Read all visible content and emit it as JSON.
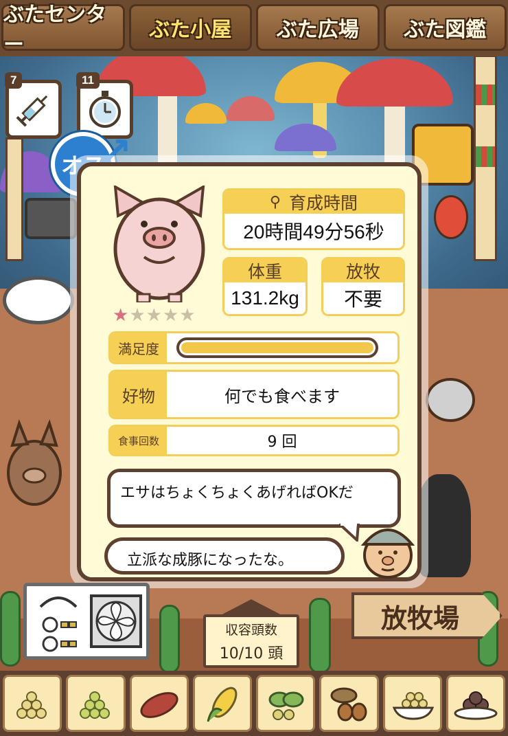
{
  "tabs": [
    {
      "label": "ぶたセンター",
      "active": false
    },
    {
      "label": "ぶた小屋",
      "active": true
    },
    {
      "label": "ぶた広場",
      "active": false
    },
    {
      "label": "ぶた図鑑",
      "active": false
    }
  ],
  "items": {
    "syringe": {
      "count": "7",
      "icon": "syringe-icon"
    },
    "stopwatch": {
      "count": "11",
      "icon": "stopwatch-icon"
    }
  },
  "gender": {
    "label": "オス",
    "icon": "male-symbol-icon"
  },
  "pig": {
    "rating": 1,
    "rating_max": 5,
    "growth_time_label": "育成時間",
    "growth_time_value": "20時間49分56秒",
    "weight_label": "体重",
    "weight_value": "131.2kg",
    "grazing_label": "放牧",
    "grazing_value": "不要",
    "satisfaction_label": "満足度",
    "satisfaction_level": 1.0,
    "favorite_label": "好物",
    "favorite_value": "何でも食べます",
    "meals_label": "食事回数",
    "meals_value": "9 回"
  },
  "dialogue": {
    "line1": "エサはちょくちょくあげればOKだ",
    "line2": "立派な成豚になったな。"
  },
  "capacity": {
    "label": "収容頭数",
    "value": "10/10 頭"
  },
  "pasture_button": "放牧場",
  "feeds": [
    {
      "name": "grain-feed-icon"
    },
    {
      "name": "green-grain-feed-icon"
    },
    {
      "name": "sweet-potato-icon"
    },
    {
      "name": "corn-icon"
    },
    {
      "name": "herbs-feed-icon"
    },
    {
      "name": "acorn-icon"
    },
    {
      "name": "bowl-feed-icon"
    },
    {
      "name": "premium-feed-icon"
    }
  ],
  "colors": {
    "accent_yellow": "#f6cf55",
    "frame_brown": "#5d4030",
    "panel_cream": "#fffbd6",
    "male_blue": "#2d7fd0",
    "star_on": "#d9707f"
  }
}
